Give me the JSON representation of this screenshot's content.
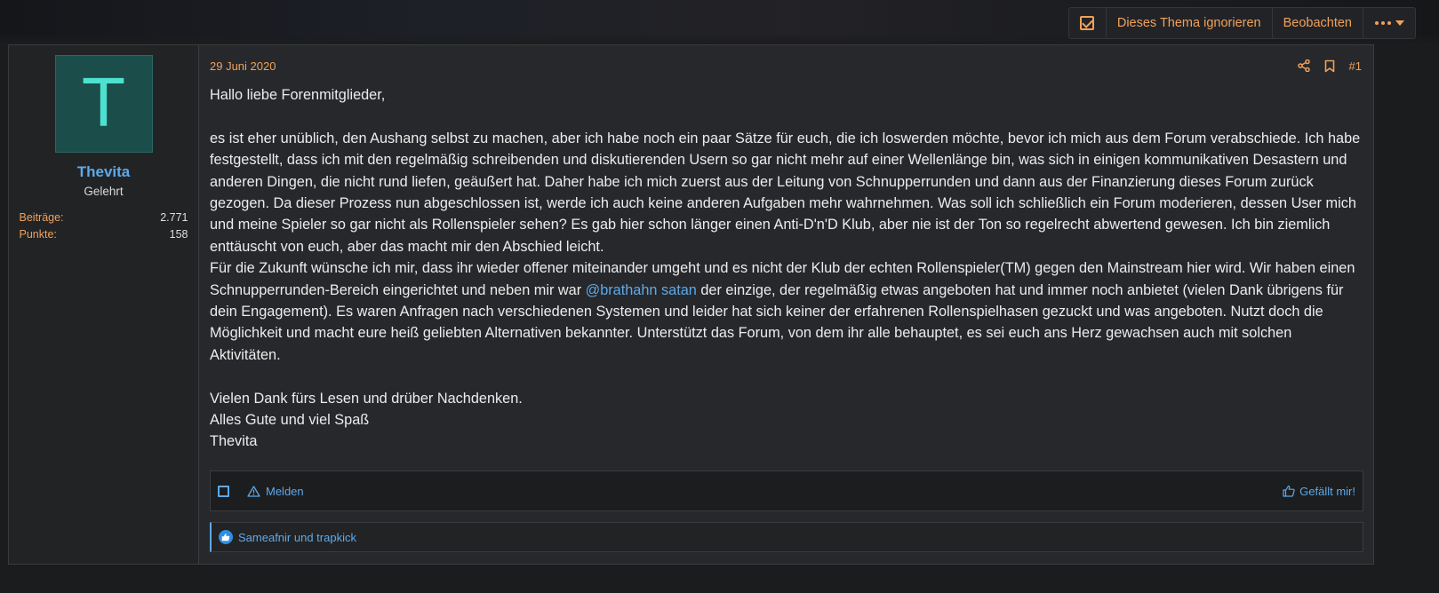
{
  "thread_actions": {
    "ignore_label": "Dieses Thema ignorieren",
    "watch_label": "Beobachten"
  },
  "user": {
    "avatar_letter": "T",
    "name": "Thevita",
    "title": "Gelehrt",
    "stats": [
      {
        "label": "Beiträge:",
        "value": "2.771"
      },
      {
        "label": "Punkte:",
        "value": "158"
      }
    ]
  },
  "post": {
    "date": "29 Juni 2020",
    "number": "#1",
    "greeting": "Hallo liebe Forenmitglieder,",
    "para1": "es ist eher unüblich, den Aushang selbst zu machen, aber ich habe noch ein paar Sätze für euch, die ich loswerden möchte, bevor ich mich aus dem Forum verabschiede. Ich habe festgestellt, dass ich mit den regelmäßig schreibenden und diskutierenden Usern so gar nicht mehr auf einer Wellenlänge bin, was sich in einigen kommunikativen Desastern und anderen Dingen, die nicht rund liefen, geäußert hat. Daher habe ich mich zuerst aus der Leitung von Schnupperrunden und dann aus der Finanzierung dieses Forum zurück gezogen. Da dieser Prozess nun abgeschlossen ist, werde ich auch keine anderen Aufgaben mehr wahrnehmen. Was soll ich schließlich ein Forum moderieren, dessen User mich und meine Spieler so gar nicht als Rollenspieler sehen? Es gab hier schon länger einen Anti-D'n'D Klub, aber nie ist der Ton so regelrecht abwertend gewesen. Ich bin ziemlich enttäuscht von euch, aber das macht mir den Abschied leicht.",
    "para2_before": "Für die Zukunft wünsche ich mir, dass ihr wieder offener miteinander umgeht und es nicht der Klub der echten Rollenspieler(TM) gegen den Mainstream hier wird. Wir haben einen Schnupperrunden-Bereich eingerichtet und neben mir war ",
    "mention": "@brathahn satan",
    "para2_after": " der einzige, der regelmäßig etwas angeboten hat und immer noch anbietet (vielen Dank übrigens für dein Engagement). Es waren Anfragen nach verschiedenen Systemen und leider hat sich keiner der erfahrenen Rollenspielhasen gezuckt und was angeboten. Nutzt doch die Möglichkeit und macht eure heiß geliebten Alternativen bekannter. Unterstützt das Forum, von dem ihr alle behauptet, es sei euch ans Herz gewachsen auch mit solchen Aktivitäten.",
    "closing1": "Vielen Dank fürs Lesen und drüber Nachdenken.",
    "closing2": "Alles Gute und viel Spaß",
    "signature": "Thevita"
  },
  "footer": {
    "report_label": "Melden",
    "like_label": "Gefällt mir!"
  },
  "reactions": {
    "text": "Sameafnir und trapkick"
  }
}
